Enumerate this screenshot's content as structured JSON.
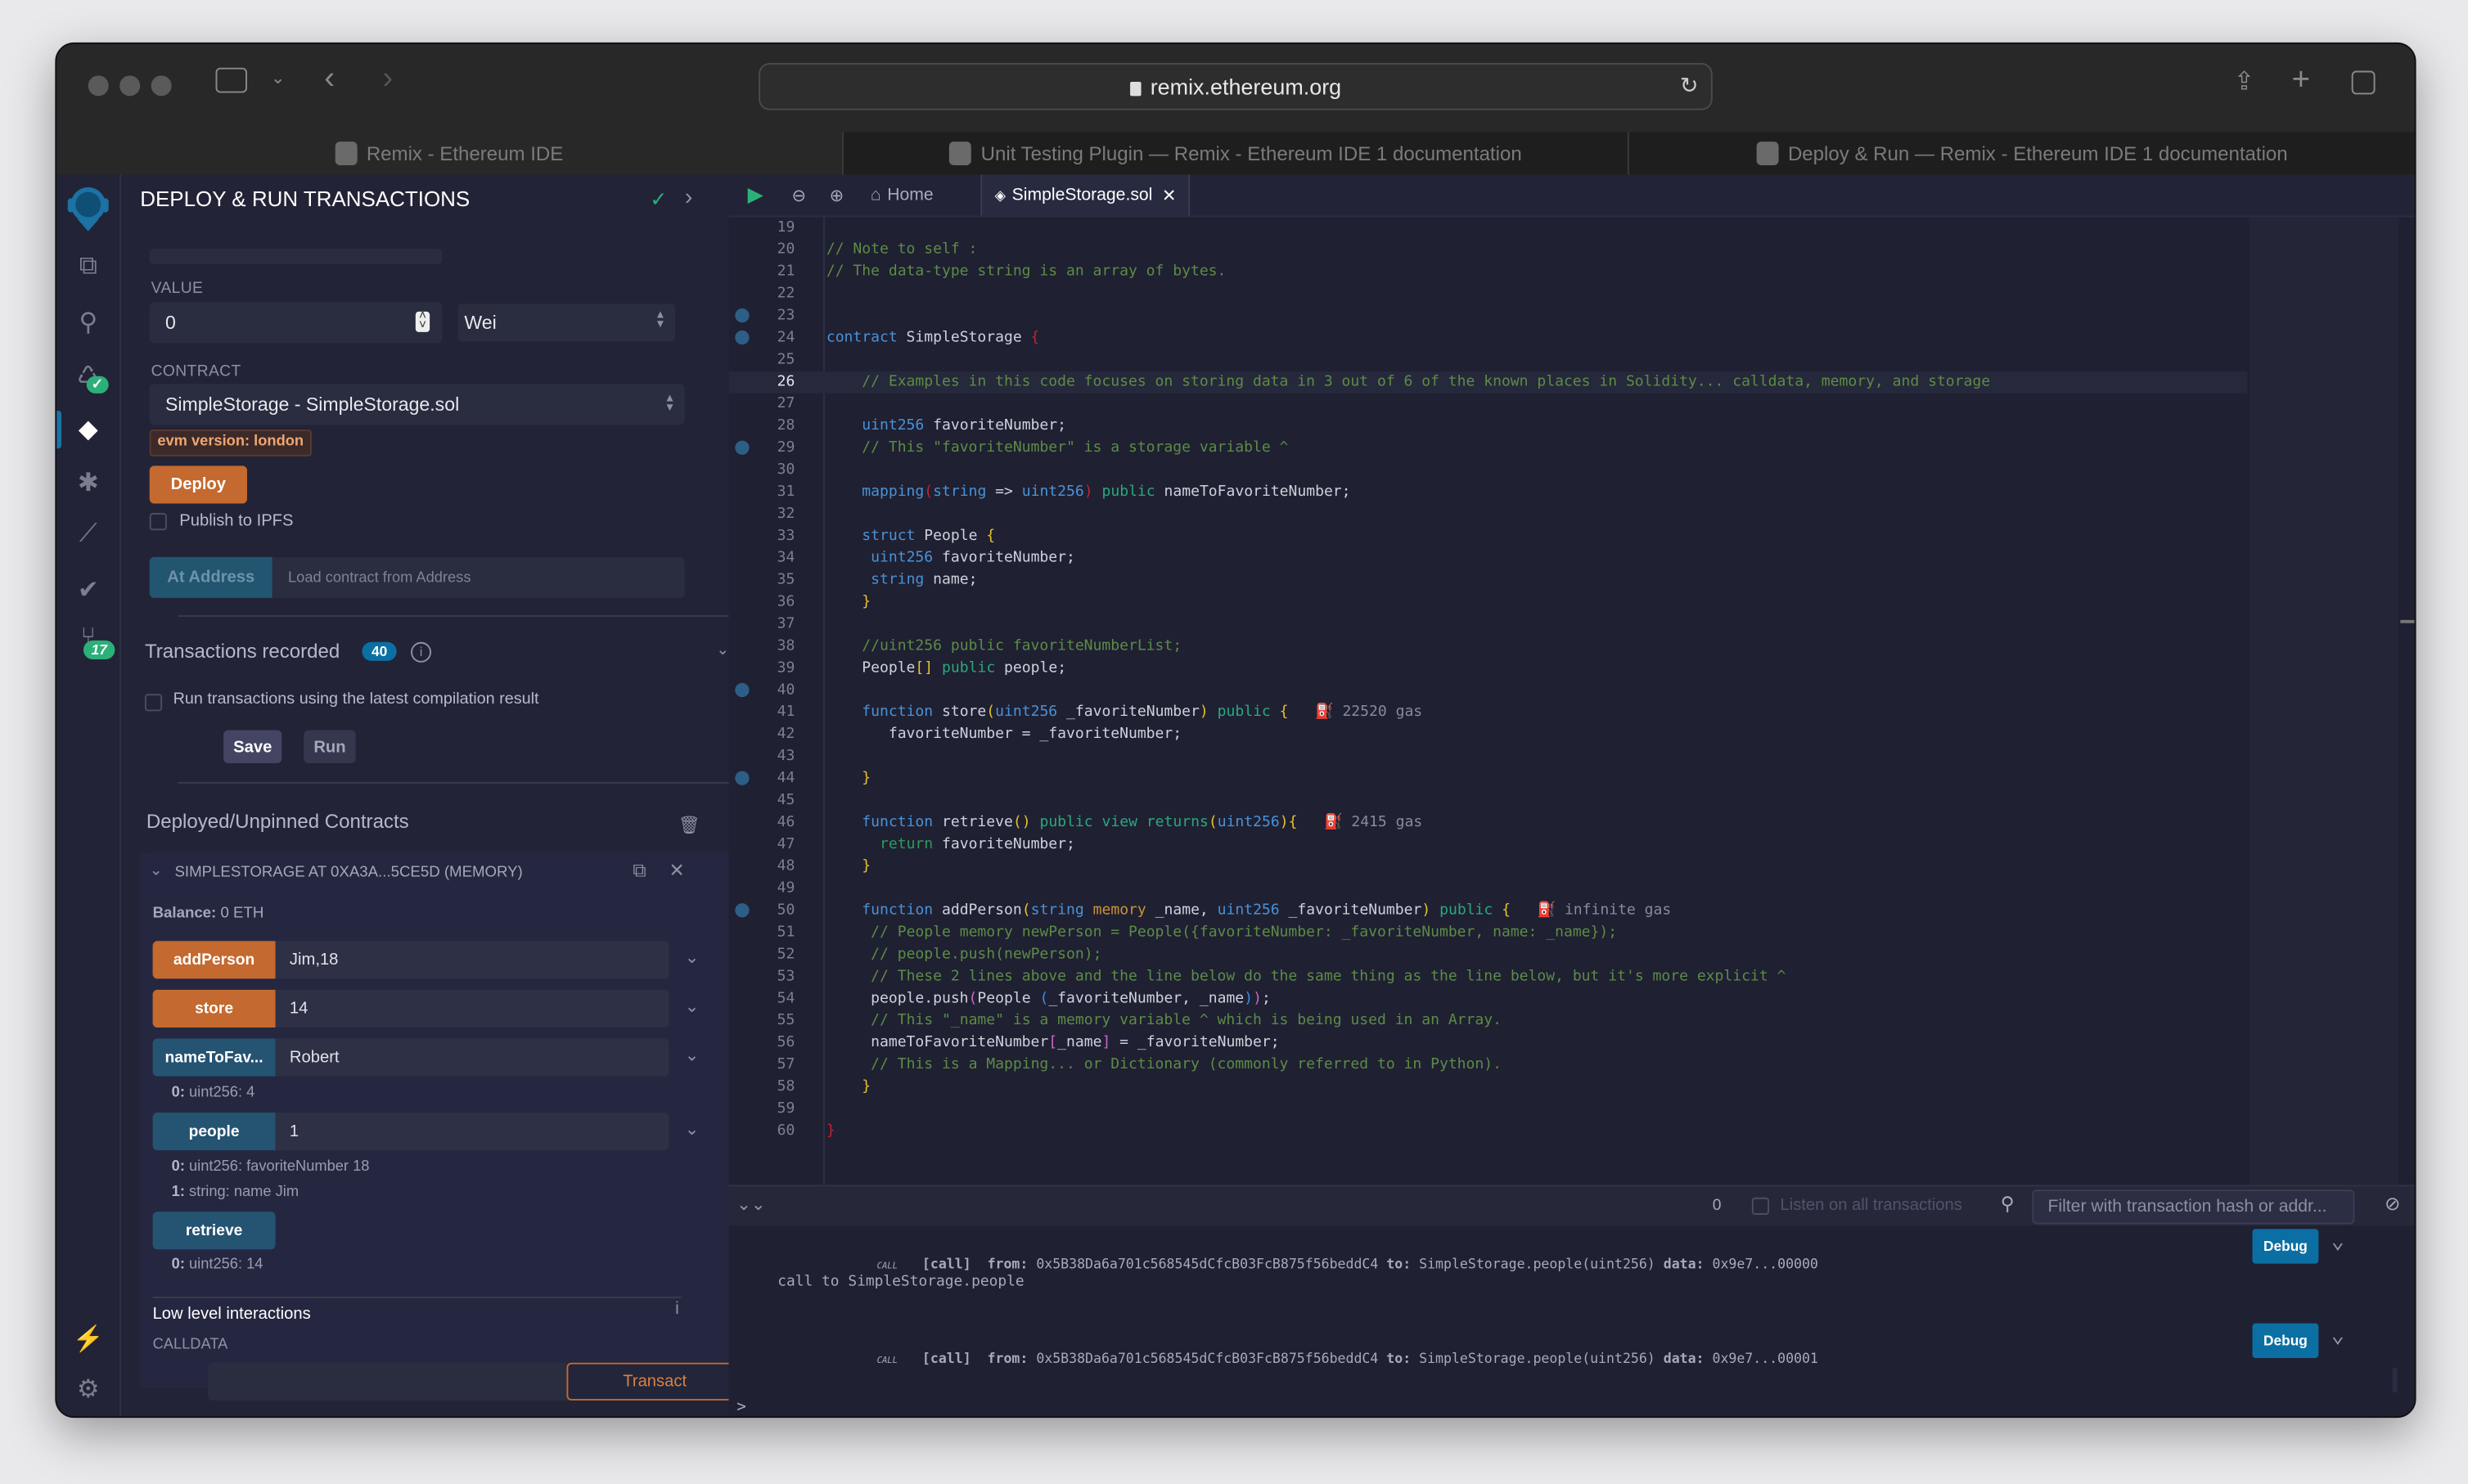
{
  "browser": {
    "url": "remix.ethereum.org",
    "tabs": [
      {
        "label": "Remix - Ethereum IDE"
      },
      {
        "label": "Unit Testing Plugin — Remix - Ethereum IDE 1 documentation"
      },
      {
        "label": "Deploy & Run — Remix - Ethereum IDE 1 documentation"
      }
    ]
  },
  "iconbar": {
    "items": [
      {
        "name": "remix-logo-icon"
      },
      {
        "name": "file-explorer-icon"
      },
      {
        "name": "search-icon"
      },
      {
        "name": "solidity-compiler-icon"
      },
      {
        "name": "deploy-run-icon"
      },
      {
        "name": "debugger-icon"
      },
      {
        "name": "analytics-icon"
      },
      {
        "name": "unit-testing-icon"
      },
      {
        "name": "git-icon"
      }
    ],
    "git_badge": "17",
    "plugin_manager": "plugin-icon",
    "settings": "settings-icon"
  },
  "side": {
    "title": "DEPLOY & RUN TRANSACTIONS",
    "value_label": "VALUE",
    "value": "0",
    "unit": "Wei",
    "contract_label": "CONTRACT",
    "contract": "SimpleStorage - SimpleStorage.sol",
    "evm_badge": "evm version: london",
    "deploy_label": "Deploy",
    "publish_ipfs": "Publish to IPFS",
    "at_address_label": "At Address",
    "at_address_placeholder": "Load contract from Address",
    "tx_recorded_label": "Transactions recorded",
    "tx_recorded_count": "40",
    "run_latest_label": "Run transactions using the latest compilation result",
    "save_label": "Save",
    "run_label": "Run",
    "deployed_title": "Deployed/Unpinned Contracts",
    "instance_title": "SIMPLESTORAGE AT 0XA3A...5CE5D (MEMORY)",
    "balance_label": "Balance:",
    "balance_value": "0 ETH",
    "functions": [
      {
        "name": "addPerson",
        "value": "Jim,18",
        "kind": "transact"
      },
      {
        "name": "store",
        "value": "14",
        "kind": "transact"
      },
      {
        "name": "nameToFav...",
        "value": "Robert",
        "kind": "call"
      },
      {
        "name": "people",
        "value": "1",
        "kind": "call"
      },
      {
        "name": "retrieve",
        "value": "",
        "kind": "call"
      }
    ],
    "outputs": {
      "nameToFav": [
        {
          "idx": "0:",
          "text": "uint256: 4"
        }
      ],
      "people": [
        {
          "idx": "0:",
          "text": "uint256: favoriteNumber 18"
        },
        {
          "idx": "1:",
          "text": "string: name Jim"
        }
      ],
      "retrieve": [
        {
          "idx": "0:",
          "text": "uint256: 14"
        }
      ]
    },
    "low_level_label": "Low level interactions",
    "calldata_label": "CALLDATA",
    "transact_label": "Transact"
  },
  "editor": {
    "tabs": {
      "home": "Home",
      "file": "SimpleStorage.sol"
    },
    "current_line": 26,
    "lines": [
      {
        "n": "19",
        "html": ""
      },
      {
        "n": "20",
        "html": "<span class='c'>// Note to self :</span>"
      },
      {
        "n": "21",
        "html": "<span class='c'>// The data-type string is an array of bytes.</span>"
      },
      {
        "n": "22",
        "html": ""
      },
      {
        "n": "23",
        "html": "",
        "bp": true
      },
      {
        "n": "24",
        "html": "<span class='k'>contract</span> SimpleStorage <span class='r'>{</span>",
        "bp": true
      },
      {
        "n": "25",
        "html": ""
      },
      {
        "n": "26",
        "html": "    <span class='c'>// Examples in this code focuses on storing data in 3 out of 6 of the known places in Solidity... calldata, memory, and storage</span>",
        "hl": true
      },
      {
        "n": "27",
        "html": ""
      },
      {
        "n": "28",
        "html": "    <span class='k'>uint256</span> favoriteNumber;"
      },
      {
        "n": "29",
        "html": "    <span class='c'>// This \"favoriteNumber\" is a storage variable ^</span>",
        "bp": true
      },
      {
        "n": "30",
        "html": ""
      },
      {
        "n": "31",
        "html": "    <span class='k'>mapping</span><span class='r'>(</span><span class='k'>string</span> =&gt; <span class='k'>uint256</span><span class='r'>)</span> <span class='g'>public</span> nameToFavoriteNumber;"
      },
      {
        "n": "32",
        "html": ""
      },
      {
        "n": "33",
        "html": "    <span class='k'>struct</span> People <span class='y'>{</span>"
      },
      {
        "n": "34",
        "html": "     <span class='k'>uint256</span> favoriteNumber;"
      },
      {
        "n": "35",
        "html": "     <span class='k'>string</span> name;"
      },
      {
        "n": "36",
        "html": "    <span class='y'>}</span>"
      },
      {
        "n": "37",
        "html": ""
      },
      {
        "n": "38",
        "html": "    <span class='c'>//uint256 public favoriteNumberList;</span>"
      },
      {
        "n": "39",
        "html": "    People<span class='y'>[]</span> <span class='g'>public</span> people;"
      },
      {
        "n": "40",
        "html": "",
        "bp": true
      },
      {
        "n": "41",
        "html": "    <span class='k'>function</span> store<span class='y'>(</span><span class='k'>uint256</span> _favoriteNumber<span class='y'>)</span> <span class='g'>public</span> <span class='y'>{</span>   <span class='gas'>⛽ 22520 gas</span>"
      },
      {
        "n": "42",
        "html": "       favoriteNumber = _favoriteNumber;"
      },
      {
        "n": "43",
        "html": ""
      },
      {
        "n": "44",
        "html": "    <span class='y'>}</span>",
        "bp": true
      },
      {
        "n": "45",
        "html": ""
      },
      {
        "n": "46",
        "html": "    <span class='k'>function</span> retrieve<span class='y'>()</span> <span class='g'>public</span> <span class='g'>view</span> <span class='g'>returns</span><span class='y'>(</span><span class='k'>uint256</span><span class='y'>){</span>   <span class='gas'>⛽ 2415 gas</span>"
      },
      {
        "n": "47",
        "html": "      <span class='ret'>return</span> favoriteNumber;"
      },
      {
        "n": "48",
        "html": "    <span class='y'>}</span>"
      },
      {
        "n": "49",
        "html": ""
      },
      {
        "n": "50",
        "html": "    <span class='k'>function</span> addPerson<span class='y'>(</span><span class='k'>string</span> <span class='m'>memory</span> _name, <span class='k'>uint256</span> _favoriteNumber<span class='y'>)</span> <span class='g'>public</span> <span class='y'>{</span>   <span class='gas'>⛽ infinite gas</span>",
        "bp": true
      },
      {
        "n": "51",
        "html": "     <span class='c'>// People memory newPerson = People({favoriteNumber: _favoriteNumber, name: _name});</span>"
      },
      {
        "n": "52",
        "html": "     <span class='c'>// people.push(newPerson);</span>"
      },
      {
        "n": "53",
        "html": "     <span class='c'>// These 2 lines above and the line below do the same thing as the line below, but it's more explicit ^</span>"
      },
      {
        "n": "54",
        "html": "     people.push<span class='p'>(</span>People <span class='b'>(</span>_favoriteNumber, _name<span class='b'>)</span><span class='p'>)</span>;"
      },
      {
        "n": "55",
        "html": "     <span class='c'>// This \"_name\" is a memory variable ^ which is being used in an Array.</span>"
      },
      {
        "n": "56",
        "html": "     nameToFavoriteNumber<span class='p'>[</span>_name<span class='p'>]</span> = _favoriteNumber;"
      },
      {
        "n": "57",
        "html": "     <span class='c'>// This is a Mapping... or Dictionary (commonly referred to in Python).</span>"
      },
      {
        "n": "58",
        "html": "    <span class='y'>}</span>"
      },
      {
        "n": "59",
        "html": ""
      },
      {
        "n": "60",
        "html": "<span class='r'>}</span>"
      }
    ]
  },
  "terminal": {
    "pending_count": "0",
    "listen_label": "Listen on all transactions",
    "filter_placeholder": "Filter with transaction hash or addr...",
    "entries": [
      {
        "tag": "CALL",
        "kind": "[call]",
        "from_label": "from:",
        "from": "0x5B38Da6a701c568545dCfcB03FcB875f56beddC4",
        "to_label": "to:",
        "to": "SimpleStorage.people(uint256)",
        "data_label": "data:",
        "data": "0x9e7...00000",
        "debug": "Debug",
        "note": "call to SimpleStorage.people"
      },
      {
        "tag": "CALL",
        "kind": "[call]",
        "from_label": "from:",
        "from": "0x5B38Da6a701c568545dCfcB03FcB875f56beddC4",
        "to_label": "to:",
        "to": "SimpleStorage.people(uint256)",
        "data_label": "data:",
        "data": "0x9e7...00001",
        "debug": "Debug",
        "note": ""
      }
    ],
    "prompt": ">"
  }
}
